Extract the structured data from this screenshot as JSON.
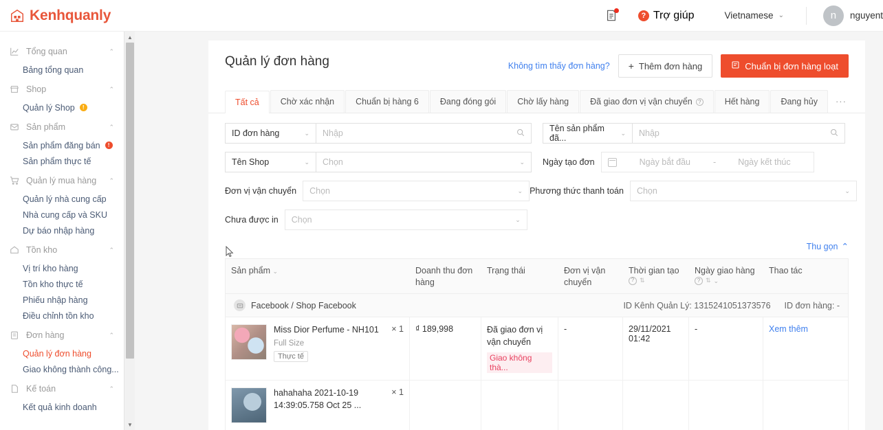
{
  "topbar": {
    "brand": "Kenhquanly",
    "doc_icon": "document-icon",
    "help_icon": "question-icon",
    "help_label": "Trợ giúp",
    "language": "Vietnamese",
    "avatar_letter": "n",
    "username": "nguyent"
  },
  "sidebar": {
    "groups": [
      {
        "icon": "chart-line-icon",
        "label": "Tổng quan",
        "items": [
          {
            "label": "Bảng tổng quan",
            "badge": null,
            "active": false
          }
        ]
      },
      {
        "icon": "store-icon",
        "label": "Shop",
        "items": [
          {
            "label": "Quản lý Shop",
            "badge": "yellow",
            "active": false
          }
        ]
      },
      {
        "icon": "box-icon",
        "label": "Sản phẩm",
        "items": [
          {
            "label": "Sản phẩm đăng bán",
            "badge": "red",
            "active": false
          },
          {
            "label": "Sản phẩm thực tế",
            "badge": null,
            "active": false
          }
        ]
      },
      {
        "icon": "cart-icon",
        "label": "Quản lý mua hàng",
        "items": [
          {
            "label": "Quản lý nhà cung cấp",
            "badge": null,
            "active": false
          },
          {
            "label": "Nhà cung cấp và SKU",
            "badge": null,
            "active": false
          },
          {
            "label": "Dự báo nhập hàng",
            "badge": null,
            "active": false
          }
        ]
      },
      {
        "icon": "home-icon",
        "label": "Tồn kho",
        "items": [
          {
            "label": "Vị trí kho hàng",
            "badge": null,
            "active": false
          },
          {
            "label": "Tồn kho thực tế",
            "badge": null,
            "active": false
          },
          {
            "label": "Phiếu nhập hàng",
            "badge": null,
            "active": false
          },
          {
            "label": "Điều chỉnh tồn kho",
            "badge": null,
            "active": false
          }
        ]
      },
      {
        "icon": "clipboard-icon",
        "label": "Đơn hàng",
        "items": [
          {
            "label": "Quản lý đơn hàng",
            "badge": null,
            "active": true
          },
          {
            "label": "Giao không thành công...",
            "badge": null,
            "active": false
          }
        ]
      },
      {
        "icon": "file-icon",
        "label": "Kế toán",
        "items": [
          {
            "label": "Kết quả kinh doanh",
            "badge": null,
            "active": false
          }
        ]
      }
    ]
  },
  "page": {
    "title": "Quản lý đơn hàng",
    "not_found_link": "Không tìm thấy đơn hàng?",
    "add_order_button": "Thêm đơn hàng",
    "bulk_prepare_button": "Chuẩn bị đơn hàng loạt"
  },
  "tabs": [
    {
      "label": "Tất cả",
      "active": true,
      "help": false
    },
    {
      "label": "Chờ xác nhận",
      "active": false,
      "help": false
    },
    {
      "label": "Chuẩn bị hàng 6",
      "active": false,
      "help": false
    },
    {
      "label": "Đang đóng gói",
      "active": false,
      "help": false
    },
    {
      "label": "Chờ lấy hàng",
      "active": false,
      "help": false
    },
    {
      "label": "Đã giao đơn vị vận chuyển",
      "active": false,
      "help": true
    },
    {
      "label": "Hết hàng",
      "active": false,
      "help": false
    },
    {
      "label": "Đang hủy",
      "active": false,
      "help": false
    }
  ],
  "tab_overflow": "···",
  "filters": {
    "order_id_select": "ID đơn hàng",
    "order_id_placeholder": "Nhập",
    "product_name_select": "Tên sản phẩm đã...",
    "product_name_placeholder": "Nhập",
    "shop_select": "Tên Shop",
    "shop_placeholder": "Chọn",
    "created_date_label": "Ngày tạo đơn",
    "date_start_placeholder": "Ngày bắt đầu",
    "date_sep": "-",
    "date_end_placeholder": "Ngày kết thúc",
    "carrier_label": "Đơn vị vận chuyển",
    "carrier_placeholder": "Chọn",
    "payment_label": "Phương thức thanh toán",
    "payment_placeholder": "Chọn",
    "not_printed_label": "Chưa được in",
    "not_printed_placeholder": "Chọn",
    "collapse_link": "Thu gọn"
  },
  "table": {
    "headers": {
      "product": "Sản phẩm",
      "revenue": "Doanh thu đơn hàng",
      "status": "Trạng thái",
      "carrier": "Đơn vị vận chuyển",
      "created": "Thời gian tạo",
      "delivery": "Ngày giao hàng",
      "actions": "Thao tác"
    },
    "order": {
      "channel": "Facebook / Shop Facebook",
      "channel_id_label": "ID Kênh Quản Lý: 1315241051373576",
      "order_id_label": "ID đơn hàng: -",
      "rows": [
        {
          "product_name": "Miss Dior Perfume - NH101",
          "variant": "Full Size",
          "tag": "Thực tế",
          "qty": "× 1",
          "revenue": "₫ 189,998",
          "status": "Đã giao đơn vị vận chuyển",
          "status_fail": "Giao không thà...",
          "carrier": "-",
          "created": "29/11/2021 01:42",
          "delivery": "-",
          "action": "Xem thêm"
        },
        {
          "product_name": "hahahaha 2021-10-19 14:39:05.758 Oct 25 ...",
          "variant": "",
          "tag": "",
          "qty": "× 1",
          "revenue": "",
          "status": "",
          "status_fail": "",
          "carrier": "",
          "created": "",
          "delivery": "",
          "action": ""
        }
      ]
    }
  }
}
